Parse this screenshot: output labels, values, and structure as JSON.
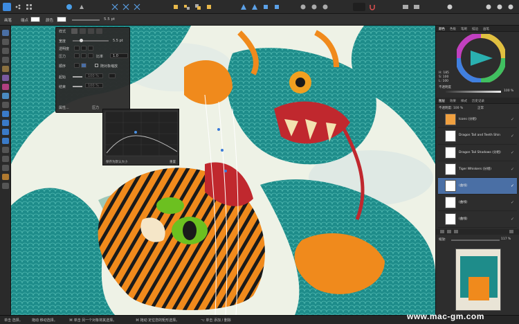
{
  "context_bar": {
    "label_brush": "画笔",
    "label_type": "端点",
    "label_color": "颜色",
    "size_value": "5.5 pt"
  },
  "brush_panel": {
    "tab_style": "样式",
    "row_width_label": "宽度",
    "row_width_value": "5.5 pt",
    "row_opacity_label": "透明度",
    "row_pressure_label": "压力",
    "row_ratio_label": "比率",
    "row_ratio_value": "1.0",
    "row_order_label": "顺序",
    "checkbox_label": "随对象缩放",
    "row_start_label": "起始",
    "row_end_label": "结束",
    "start_value": "100 %",
    "end_value": "100 %",
    "pressure_tab": "压力",
    "properties_tab": "属性..."
  },
  "curve_panel": {
    "reset_label": "保存为默认大小",
    "done_label": "重置"
  },
  "color_panel": {
    "tabs": [
      "颜色",
      "色板",
      "笔刷",
      "描边",
      "画笔"
    ],
    "h_label": "H: 185",
    "s_label": "S: 100",
    "l_label": "L: 100",
    "opacity_label": "不透明度",
    "opacity_value": "100 %"
  },
  "layers_panel": {
    "tabs": [
      "图层",
      "效果",
      "样式",
      "历史记录"
    ],
    "opacity_label": "不透明度: 100 %",
    "blend_mode": "正常",
    "layers": [
      {
        "name": "Icons",
        "suffix": "(分组)"
      },
      {
        "name": "Dragon Tail and Teeth Shin",
        "suffix": ""
      },
      {
        "name": "Dragon Tail Shadows",
        "suffix": "(分组)"
      },
      {
        "name": "Tiger Whiskers",
        "suffix": "(分组)"
      },
      {
        "name": "(曲线)",
        "suffix": ""
      },
      {
        "name": "(曲线)",
        "suffix": ""
      },
      {
        "name": "(曲线)",
        "suffix": ""
      }
    ]
  },
  "navigator": {
    "zoom_label": "缩放:",
    "zoom_value": "117 %"
  },
  "status_bar": {
    "hint1": "单击 选择。",
    "hint2": "拖动 移动选择。",
    "hint3": "⌘ 单击 另一个对象将其选择。",
    "hint4": "⌘ 拖动 定位您的矩形选择。",
    "hint5": "⌥ 单击 添加 / 删除"
  },
  "watermark": "www.mac-gm.com",
  "colors": {
    "accent": "#4a6fa5",
    "dragon_teal": "#1e8c8a",
    "tiger_orange": "#f08a1c"
  }
}
